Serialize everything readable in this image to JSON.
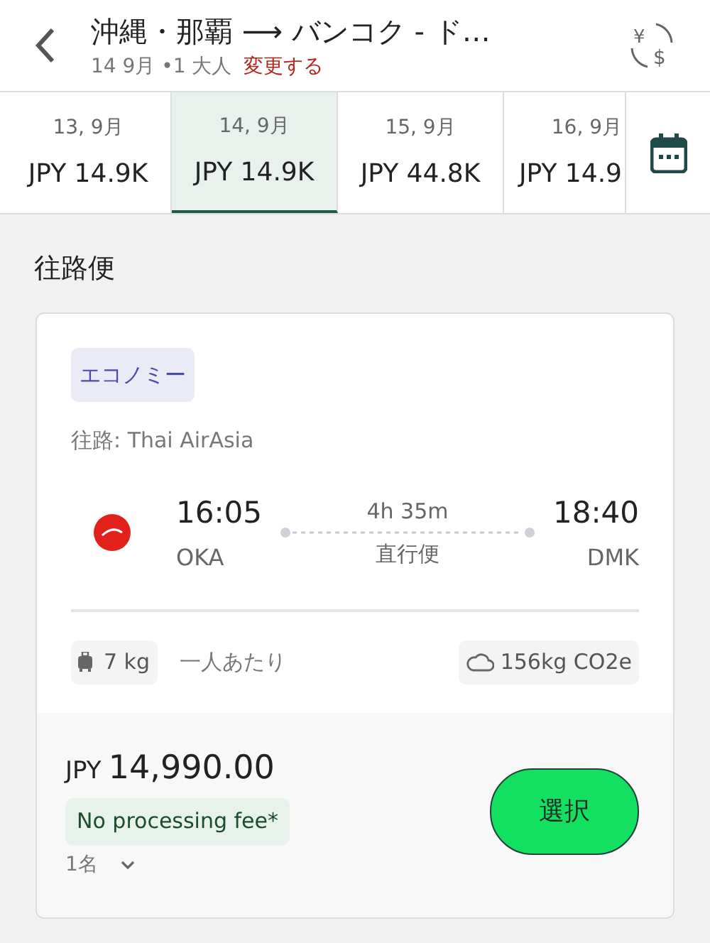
{
  "header": {
    "title": "沖縄・那覇 ⟶ バンコク - ド…",
    "date": "14 9月",
    "travellers": "•1 大人",
    "change_link": "変更する",
    "currency_symbols": [
      "¥",
      "$"
    ]
  },
  "date_tabs": [
    {
      "date": "13, 9月",
      "price": "JPY 14.9K",
      "selected": false
    },
    {
      "date": "14, 9月",
      "price": "JPY 14.9K",
      "selected": true
    },
    {
      "date": "15, 9月",
      "price": "JPY 44.8K",
      "selected": false
    },
    {
      "date": "16, 9月",
      "price": "JPY 14.9",
      "selected": false
    }
  ],
  "section_title": "往路便",
  "flight": {
    "cabin": "エコノミー",
    "airline_line": "往路: Thai AirAsia",
    "depart_time": "16:05",
    "depart_airport": "OKA",
    "duration": "4h 35m",
    "stops": "直行便",
    "arrive_time": "18:40",
    "arrive_airport": "DMK",
    "baggage": "7 kg",
    "baggage_note": "一人あたり",
    "emission": "156kg CO2e",
    "currency": "JPY",
    "price": "14,990.00",
    "fee_badge": "No processing fee*",
    "passengers": "1名",
    "select_button": "選択"
  }
}
